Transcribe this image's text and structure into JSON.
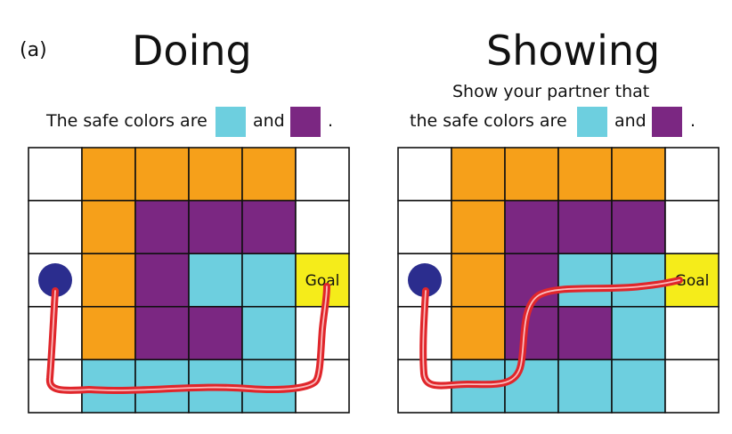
{
  "panel_label": "(a)",
  "colors": {
    "white": "#ffffff",
    "orange": "#f6a01a",
    "purple": "#7b2782",
    "cyan": "#6dcfdf",
    "yellow": "#f5ec1a",
    "agent": "#2b2d8e",
    "path": "#e0262b",
    "grid_line": "#111111"
  },
  "legend_icons": [
    "cyan-swatch",
    "purple-swatch"
  ],
  "left_panel": {
    "title": "Doing",
    "instruction_before": "The safe colors are",
    "instruction_and": "and",
    "instruction_end": ".",
    "grid": [
      [
        "W",
        "O",
        "O",
        "O",
        "O",
        "W"
      ],
      [
        "W",
        "O",
        "P",
        "P",
        "P",
        "W"
      ],
      [
        "W",
        "O",
        "P",
        "C",
        "C",
        "Y"
      ],
      [
        "W",
        "O",
        "P",
        "P",
        "C",
        "W"
      ],
      [
        "W",
        "C",
        "C",
        "C",
        "C",
        "W"
      ]
    ],
    "goal_label": "Goal"
  },
  "right_panel": {
    "title": "Showing",
    "instruction_line1": "Show your partner that",
    "instruction_before": "the safe colors are",
    "instruction_and": "and",
    "instruction_end": ".",
    "grid": [
      [
        "W",
        "O",
        "O",
        "O",
        "O",
        "W"
      ],
      [
        "W",
        "O",
        "P",
        "P",
        "P",
        "W"
      ],
      [
        "W",
        "O",
        "P",
        "C",
        "C",
        "Y"
      ],
      [
        "W",
        "O",
        "P",
        "P",
        "C",
        "W"
      ],
      [
        "W",
        "C",
        "C",
        "C",
        "C",
        "W"
      ]
    ],
    "goal_label": "Goal"
  }
}
